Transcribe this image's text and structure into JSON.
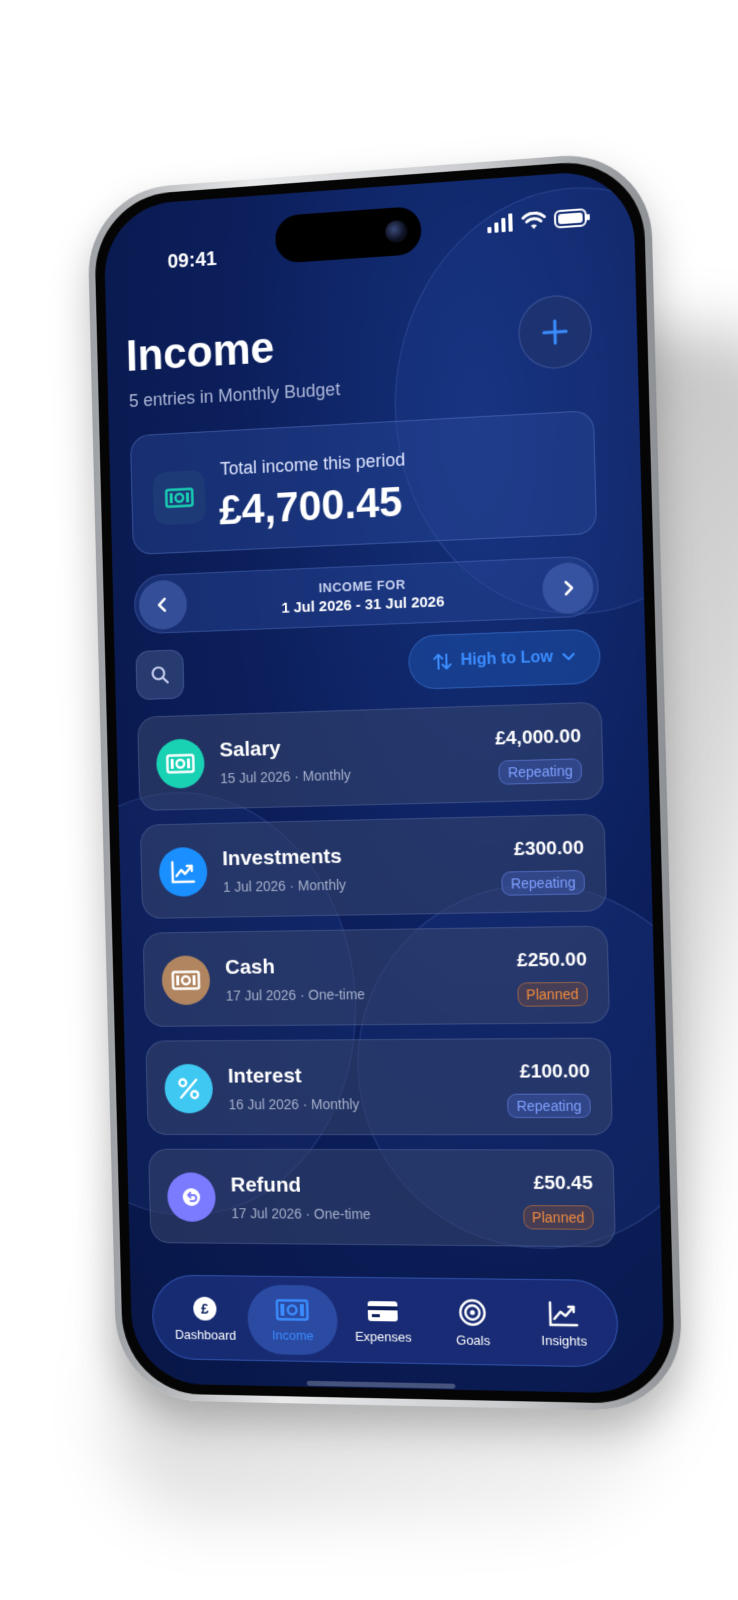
{
  "status_bar": {
    "time": "09:41"
  },
  "header": {
    "title": "Income",
    "subtitle": "5 entries in Monthly Budget"
  },
  "total": {
    "label": "Total income this period",
    "amount": "£4,700.45"
  },
  "period": {
    "label": "INCOME FOR",
    "range": "1 Jul 2026 - 31 Jul 2026"
  },
  "sort": {
    "label": "High to Low"
  },
  "entries": [
    {
      "name": "Salary",
      "meta": "15 Jul 2026 · Monthly",
      "amount": "£4,000.00",
      "badge": "Repeating",
      "icon": "cash-icon",
      "color": "#19d1b3"
    },
    {
      "name": "Investments",
      "meta": "1 Jul 2026 · Monthly",
      "amount": "£300.00",
      "badge": "Repeating",
      "icon": "chart-icon",
      "color": "#1a8fff"
    },
    {
      "name": "Cash",
      "meta": "17 Jul 2026 · One-time",
      "amount": "£250.00",
      "badge": "Planned",
      "icon": "cash-icon",
      "color": "#b08560"
    },
    {
      "name": "Interest",
      "meta": "16 Jul 2026 · Monthly",
      "amount": "£100.00",
      "badge": "Repeating",
      "icon": "percent-icon",
      "color": "#3fc8f2"
    },
    {
      "name": "Refund",
      "meta": "17 Jul 2026 · One-time",
      "amount": "£50.45",
      "badge": "Planned",
      "icon": "refund-icon",
      "color": "#7a7bff"
    }
  ],
  "tabs": [
    {
      "label": "Dashboard",
      "icon": "pound-icon"
    },
    {
      "label": "Income",
      "icon": "cash-icon",
      "active": true
    },
    {
      "label": "Expenses",
      "icon": "card-icon"
    },
    {
      "label": "Goals",
      "icon": "target-icon"
    },
    {
      "label": "Insights",
      "icon": "trend-icon"
    }
  ],
  "colors": {
    "accent": "#3b8dff",
    "repeating": "#7fa0ff",
    "planned": "#f08a3c",
    "background": "#0c1f5c"
  }
}
